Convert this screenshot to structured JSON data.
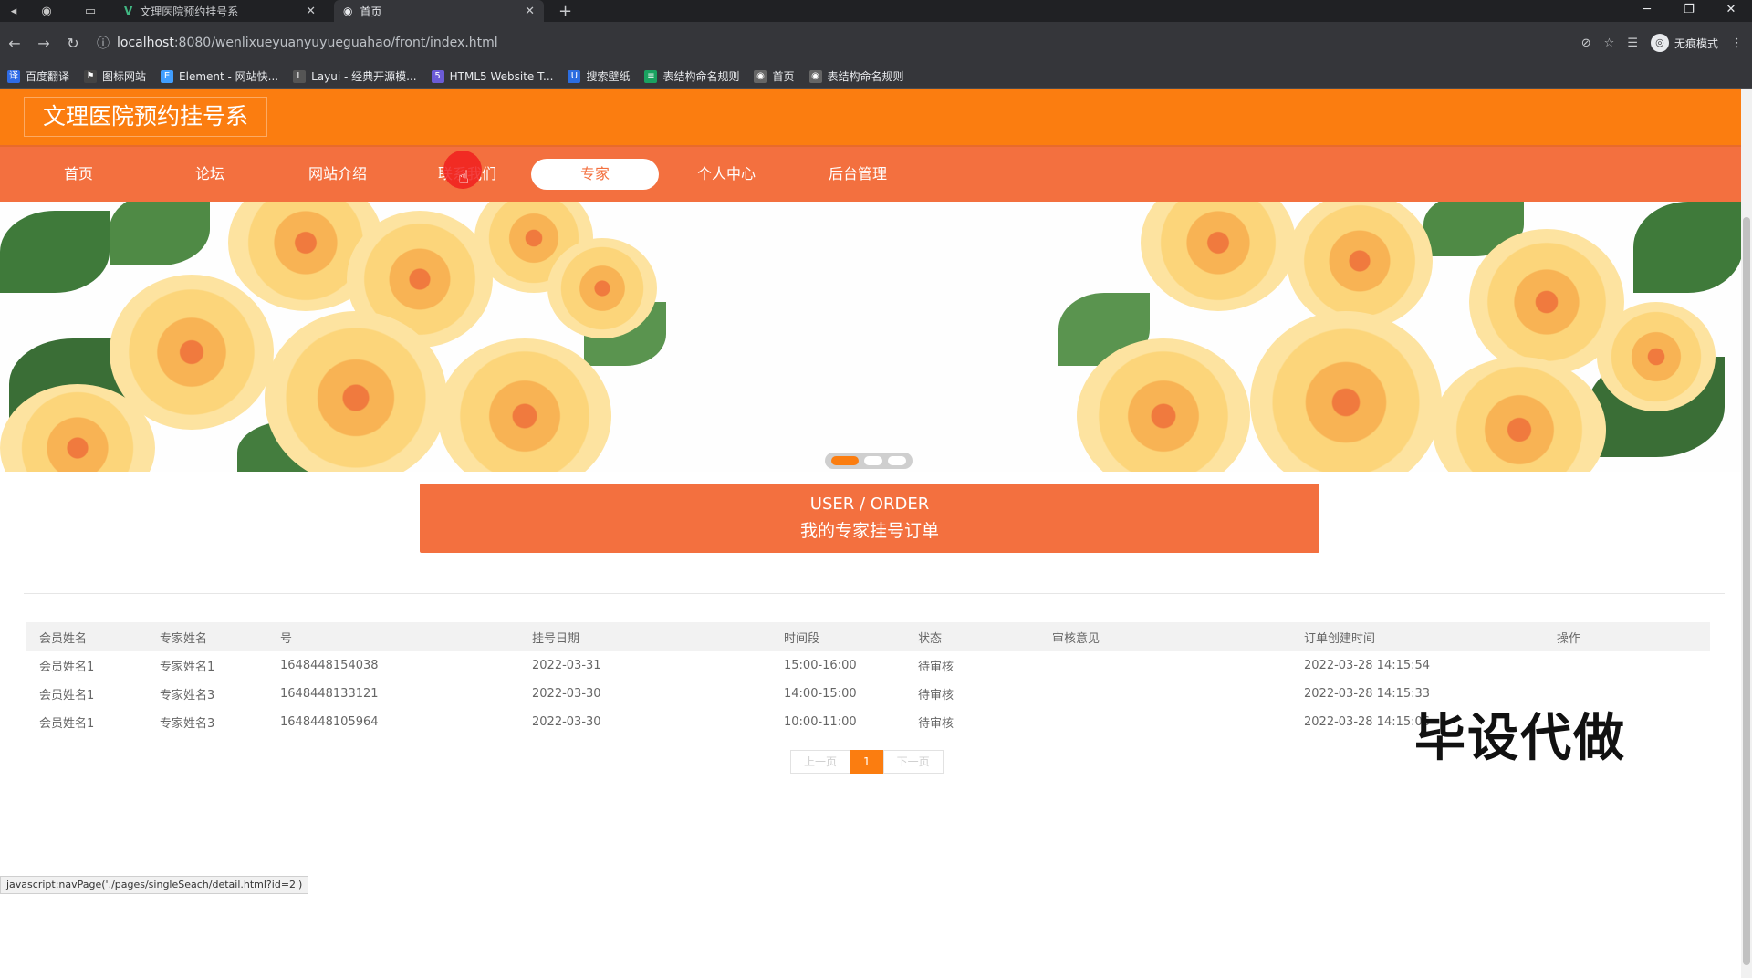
{
  "browser": {
    "tabs": [
      {
        "title": "文理医院预约挂号系",
        "icon": "vue-logo-icon"
      },
      {
        "title": "首页",
        "icon": "globe-icon"
      }
    ],
    "url_host": "localhost",
    "url_rest": ":8080/wenlixueyuanyuyueguahao/front/index.html",
    "incognito_label": "无痕模式",
    "bookmarks": [
      "百度翻译",
      "图标网站",
      "Element - 网站快...",
      "Layui - 经典开源模...",
      "HTML5 Website T...",
      "搜索壁纸",
      "表结构命名规则",
      "首页",
      "表结构命名规则"
    ]
  },
  "site": {
    "title": "文理医院预约挂号系",
    "nav": [
      "首页",
      "论坛",
      "网站介绍",
      "联系我们",
      "专家",
      "个人中心",
      "后台管理"
    ],
    "active_nav_index": 4,
    "accent_color": "#fb7d10",
    "nav_color": "#f3703f"
  },
  "order_banner": {
    "en": "USER / ORDER",
    "cn": "我的专家挂号订单"
  },
  "table": {
    "headers": [
      "会员姓名",
      "专家姓名",
      "号",
      "挂号日期",
      "时间段",
      "状态",
      "审核意见",
      "订单创建时间",
      "操作"
    ],
    "rows": [
      [
        "会员姓名1",
        "专家姓名1",
        "1648448154038",
        "2022-03-31",
        "15:00-16:00",
        "待审核",
        "",
        "2022-03-28 14:15:54",
        ""
      ],
      [
        "会员姓名1",
        "专家姓名3",
        "1648448133121",
        "2022-03-30",
        "14:00-15:00",
        "待审核",
        "",
        "2022-03-28 14:15:33",
        ""
      ],
      [
        "会员姓名1",
        "专家姓名3",
        "1648448105964",
        "2022-03-30",
        "10:00-11:00",
        "待审核",
        "",
        "2022-03-28 14:15:06",
        ""
      ]
    ]
  },
  "pager": {
    "prev": "上一页",
    "current": "1",
    "next": "下一页"
  },
  "watermark": "毕设代做",
  "status_url": "javascript:navPage('./pages/singleSeach/detail.html?id=2')"
}
